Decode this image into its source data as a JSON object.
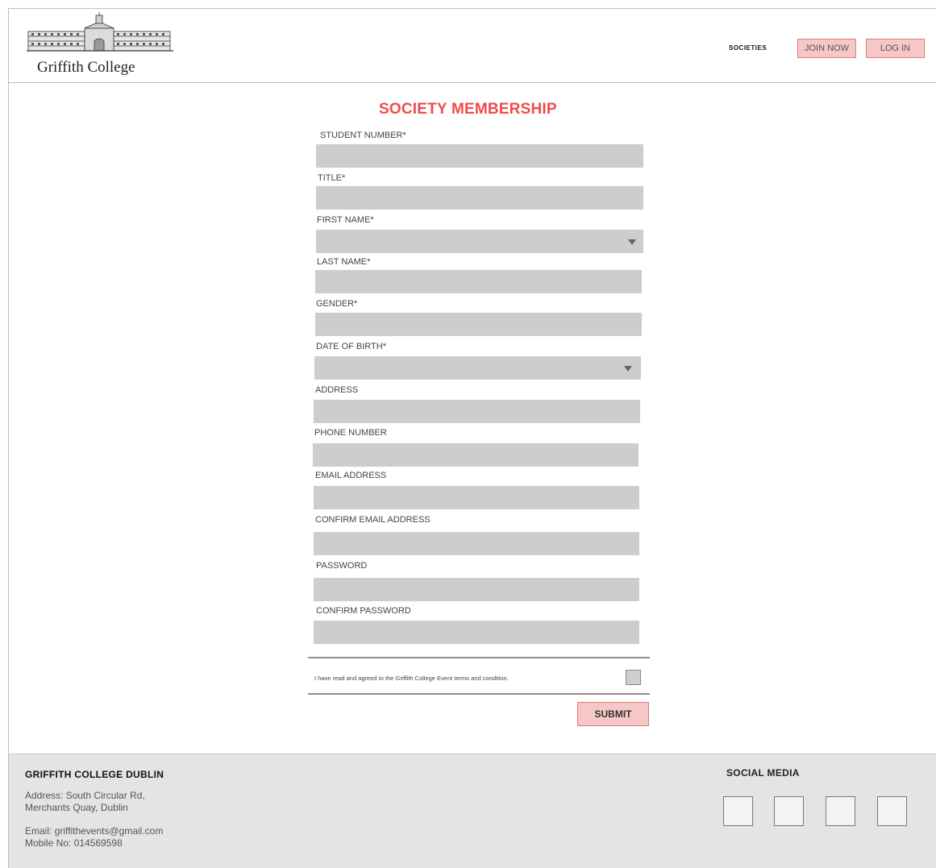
{
  "header": {
    "logo_text": "Griffith College",
    "nav": {
      "societies": "SOCIETIES",
      "join_now": "JOIN NOW",
      "log_in": "LOG IN"
    }
  },
  "form": {
    "title": "SOCIETY MEMBERSHIP",
    "fields": [
      {
        "label": "STUDENT NUMBER*",
        "type": "text",
        "value": ""
      },
      {
        "label": "TITLE*",
        "type": "text",
        "value": ""
      },
      {
        "label": "FIRST NAME*",
        "type": "select",
        "value": ""
      },
      {
        "label": "LAST NAME*",
        "type": "text",
        "value": ""
      },
      {
        "label": "GENDER*",
        "type": "text",
        "value": ""
      },
      {
        "label": "DATE OF BIRTH*",
        "type": "select",
        "value": ""
      },
      {
        "label": "ADDRESS",
        "type": "text",
        "value": ""
      },
      {
        "label": "PHONE NUMBER",
        "type": "text",
        "value": ""
      },
      {
        "label": "EMAIL ADDRESS",
        "type": "text",
        "value": ""
      },
      {
        "label": "CONFIRM EMAIL ADDRESS",
        "type": "text",
        "value": ""
      },
      {
        "label": "PASSWORD",
        "type": "text",
        "value": ""
      },
      {
        "label": "CONFIRM PASSWORD",
        "type": "text",
        "value": ""
      }
    ],
    "terms_text": "I have read and agreed to the Griffith College Event terms and condition.",
    "terms_checked": false,
    "submit_label": "SUBMIT"
  },
  "footer": {
    "title": "GRIFFITH COLLEGE DUBLIN",
    "address_line1": "Address: South Circular Rd,",
    "address_line2": "Merchants Quay, Dublin",
    "email": "Email: griffithevents@gmail.com",
    "mobile": "Mobile No: 014569598",
    "social_title": "SOCIAL MEDIA",
    "social_icons": [
      "social-icon-1",
      "social-icon-2",
      "social-icon-3",
      "social-icon-4"
    ]
  },
  "colors": {
    "accent": "#f04a4a",
    "button_fill": "#f6c7c7",
    "button_border": "#e07b7b",
    "field_fill": "#cdcdcd",
    "footer_bg": "#e4e4e4"
  }
}
